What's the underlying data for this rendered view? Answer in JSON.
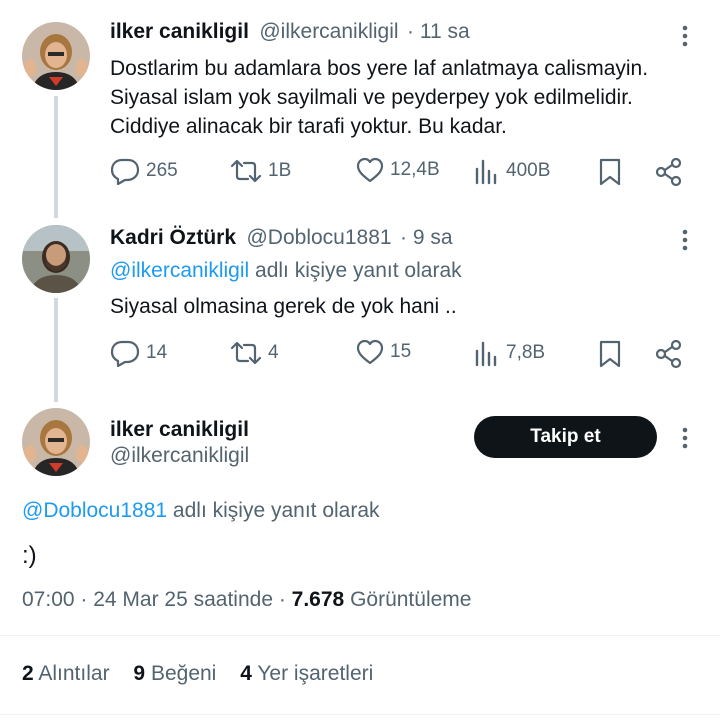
{
  "tweet1": {
    "name": "ilker canikligil",
    "handle": "@ilkercanikligil",
    "time": "· 11 sa",
    "lines": [
      "Dostlarim bu adamlara bos yere laf anlatmaya calismayin.",
      "Siyasal islam yok sayilmali ve peyderpey yok edilmelidir.",
      "Ciddiye alinacak bir tarafi yoktur. Bu kadar."
    ],
    "replies": "265",
    "retweets": "1B",
    "likes": "12,4B",
    "views": "400B"
  },
  "tweet2": {
    "name": "Kadri Öztürk",
    "handle": "@Doblocu1881",
    "time": "· 9 sa",
    "reply_to_handle": "@ilkercanikligil",
    "reply_to_suffix": " adlı kişiye yanıt olarak",
    "text": "Siyasal olmasina gerek de yok hani ..",
    "replies": "14",
    "retweets": "4",
    "likes": "15",
    "views": "7,8B"
  },
  "main_tweet": {
    "name": "ilker canikligil",
    "handle": "@ilkercanikligil",
    "follow_label": "Takip et",
    "reply_to_handle": "@Doblocu1881",
    "reply_to_suffix": " adlı kişiye yanıt olarak",
    "text": ":)",
    "timestamp": "07:00 · 24 Mar 25 saatinde · ",
    "views_count": "7.678",
    "views_label": " Görüntüleme",
    "quotes_count": "2",
    "quotes_label": "Alıntılar",
    "likes_count": "9",
    "likes_label": "Beğeni",
    "bookmarks_count": "4",
    "bookmarks_label": "Yer işaretleri"
  },
  "icons": {
    "reply": "reply-icon",
    "retweet": "retweet-icon",
    "like": "heart-icon",
    "views": "views-icon",
    "bookmark": "bookmark-icon",
    "share": "share-icon",
    "more": "more-icon"
  },
  "colors": {
    "link": "#1d9bf0",
    "muted": "#536471",
    "text": "#0f1419",
    "thread_line": "#cfd9de"
  }
}
